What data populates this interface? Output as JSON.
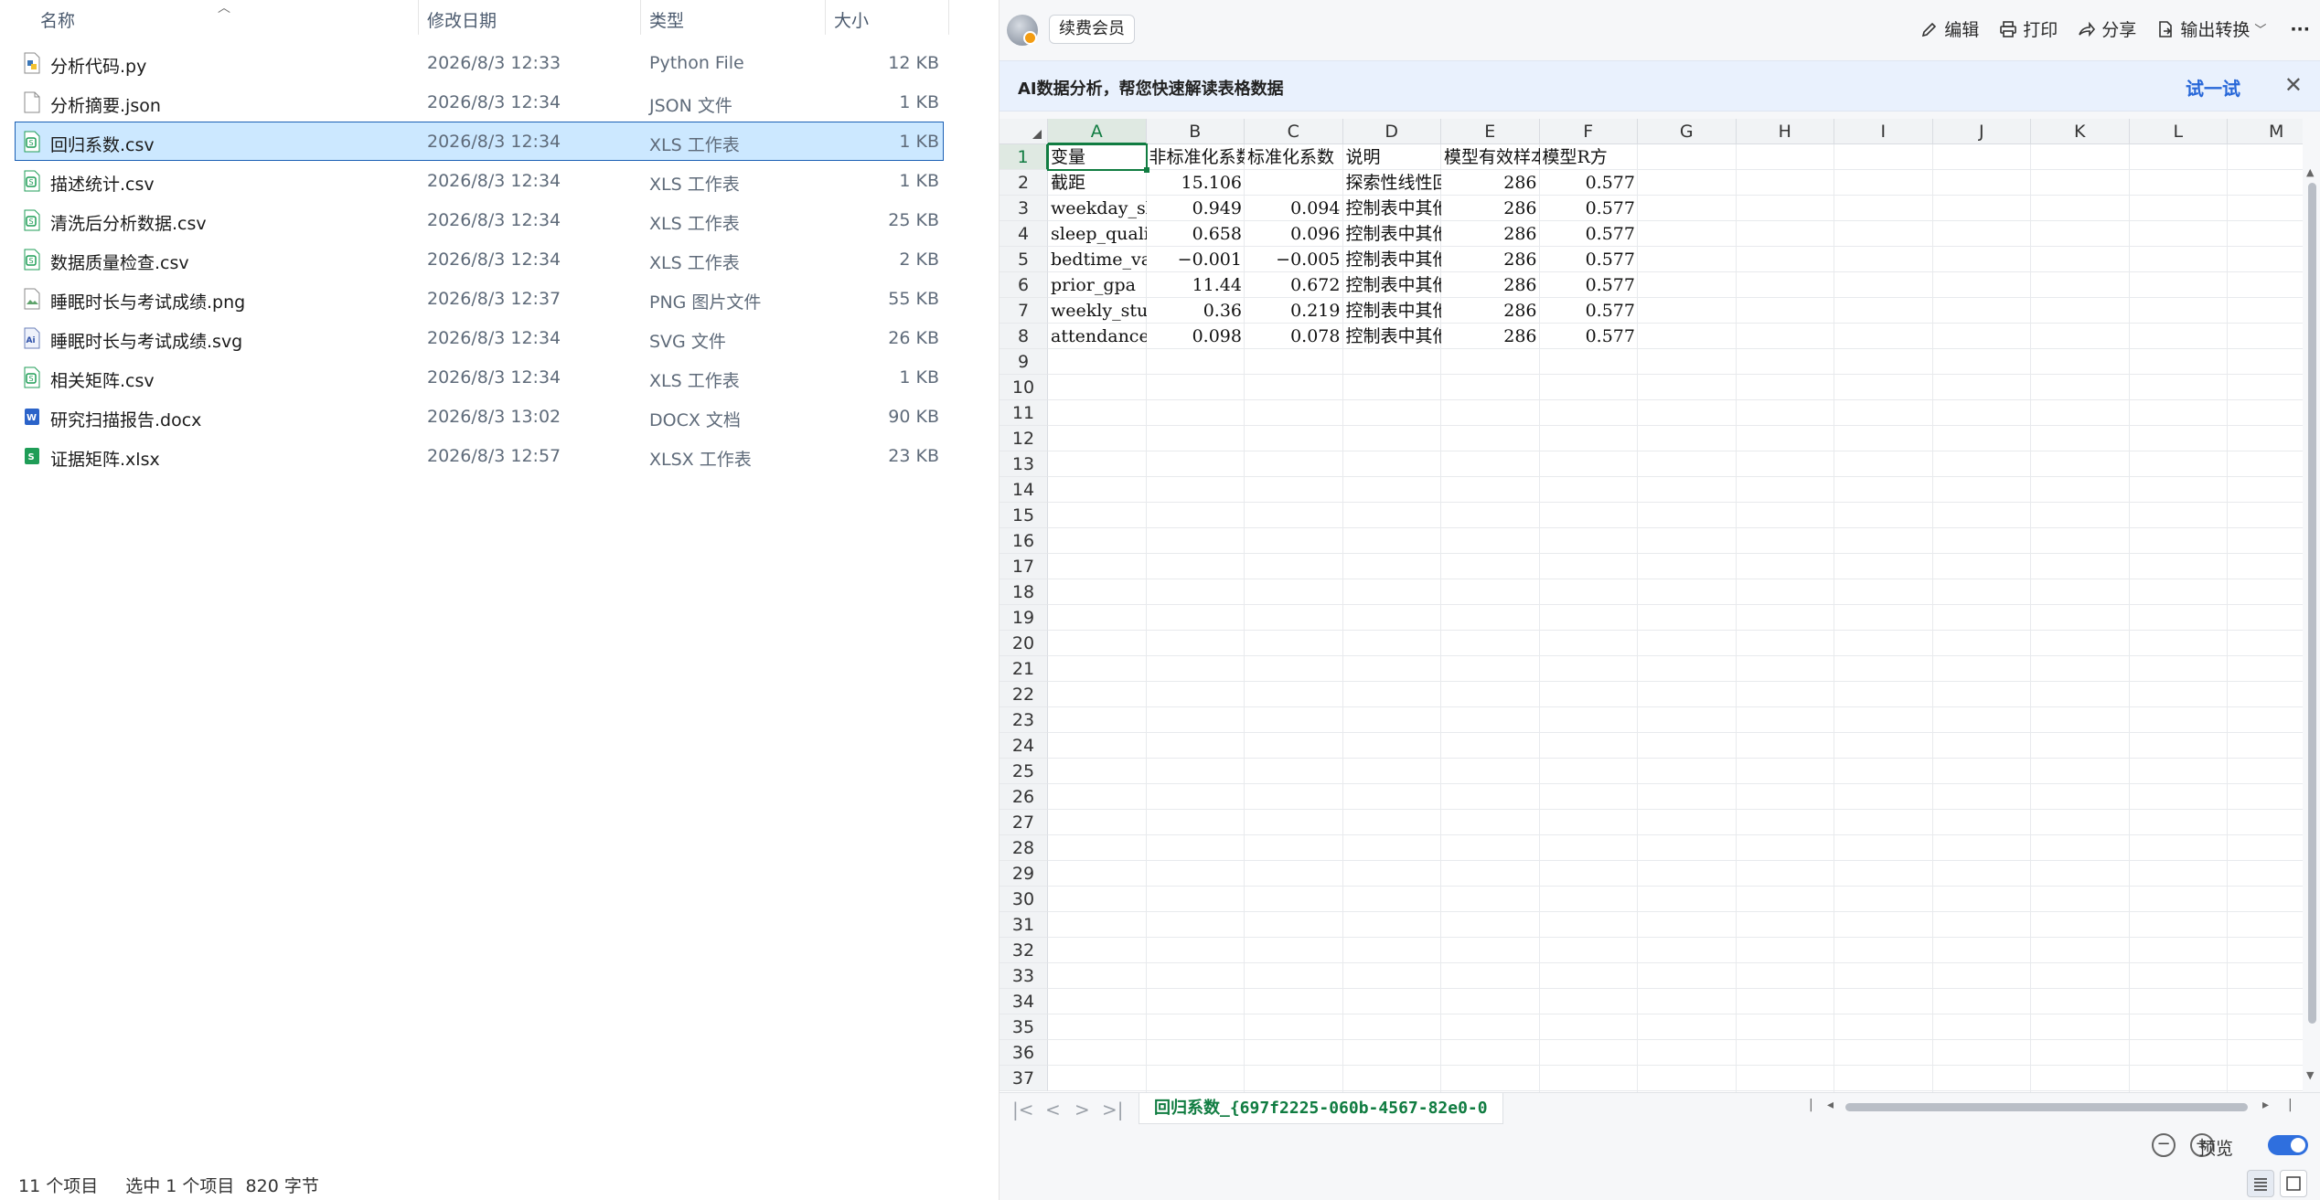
{
  "explorer": {
    "headers": {
      "name": "名称",
      "date": "修改日期",
      "type": "类型",
      "size": "大小"
    },
    "files": [
      {
        "name": "分析代码.py",
        "date": "2026/8/3 12:33",
        "type": "Python File",
        "size": "12 KB",
        "icon": "python-file-icon",
        "selected": false
      },
      {
        "name": "分析摘要.json",
        "date": "2026/8/3 12:34",
        "type": "JSON 文件",
        "size": "1 KB",
        "icon": "json-file-icon",
        "selected": false
      },
      {
        "name": "回归系数.csv",
        "date": "2026/8/3 12:34",
        "type": "XLS 工作表",
        "size": "1 KB",
        "icon": "csv-file-icon",
        "selected": true
      },
      {
        "name": "描述统计.csv",
        "date": "2026/8/3 12:34",
        "type": "XLS 工作表",
        "size": "1 KB",
        "icon": "csv-file-icon",
        "selected": false
      },
      {
        "name": "清洗后分析数据.csv",
        "date": "2026/8/3 12:34",
        "type": "XLS 工作表",
        "size": "25 KB",
        "icon": "csv-file-icon",
        "selected": false
      },
      {
        "name": "数据质量检查.csv",
        "date": "2026/8/3 12:34",
        "type": "XLS 工作表",
        "size": "2 KB",
        "icon": "csv-file-icon",
        "selected": false
      },
      {
        "name": "睡眠时长与考试成绩.png",
        "date": "2026/8/3 12:37",
        "type": "PNG 图片文件",
        "size": "55 KB",
        "icon": "image-file-icon",
        "selected": false
      },
      {
        "name": "睡眠时长与考试成绩.svg",
        "date": "2026/8/3 12:34",
        "type": "SVG 文件",
        "size": "26 KB",
        "icon": "svg-file-icon",
        "selected": false
      },
      {
        "name": "相关矩阵.csv",
        "date": "2026/8/3 12:34",
        "type": "XLS 工作表",
        "size": "1 KB",
        "icon": "csv-file-icon",
        "selected": false
      },
      {
        "name": "研究扫描报告.docx",
        "date": "2026/8/3 13:02",
        "type": "DOCX 文档",
        "size": "90 KB",
        "icon": "word-file-icon",
        "selected": false
      },
      {
        "name": "证据矩阵.xlsx",
        "date": "2026/8/3 12:57",
        "type": "XLSX 工作表",
        "size": "23 KB",
        "icon": "excel-file-icon",
        "selected": false
      }
    ],
    "status": {
      "count": "11 个项目",
      "selection": "选中 1 个项目  820 字节"
    }
  },
  "sheet": {
    "vip_label": "续费会员",
    "tools": [
      {
        "label": "编辑",
        "icon": "pencil-icon"
      },
      {
        "label": "打印",
        "icon": "printer-icon"
      },
      {
        "label": "分享",
        "icon": "share-icon"
      },
      {
        "label": "输出转换",
        "icon": "export-icon"
      }
    ],
    "more_label": "···",
    "ai_banner": {
      "text": "AI数据分析，帮您快速解读表格数据",
      "try_label": "试一试",
      "close_label": "✕"
    },
    "columns": [
      "A",
      "B",
      "C",
      "D",
      "E",
      "F",
      "G",
      "H",
      "I",
      "J",
      "K",
      "L",
      "M"
    ],
    "row_count": 37,
    "active_cell": "A1",
    "cells": [
      [
        "变量",
        "非标准化系数",
        "标准化系数",
        "说明",
        "模型有效样本",
        "模型R方"
      ],
      [
        "截距",
        "15.106",
        "",
        "探索性线性回归",
        "286",
        "0.577"
      ],
      [
        "weekday_sleep",
        "0.949",
        "0.094",
        "控制表中其他变量",
        "286",
        "0.577"
      ],
      [
        "sleep_quality",
        "0.658",
        "0.096",
        "控制表中其他变量",
        "286",
        "0.577"
      ],
      [
        "bedtime_variability",
        "−0.001",
        "−0.005",
        "控制表中其他变量",
        "286",
        "0.577"
      ],
      [
        "prior_gpa",
        "11.44",
        "0.672",
        "控制表中其他变量",
        "286",
        "0.577"
      ],
      [
        "weekly_study_hours",
        "0.36",
        "0.219",
        "控制表中其他变量",
        "286",
        "0.577"
      ],
      [
        "attendance",
        "0.098",
        "0.078",
        "控制表中其他变量",
        "286",
        "0.577"
      ]
    ],
    "sheet_tab": "回归系数_{697f2225-060b-4567-82e0-0",
    "preview_label": "预览",
    "preview_on": true
  }
}
